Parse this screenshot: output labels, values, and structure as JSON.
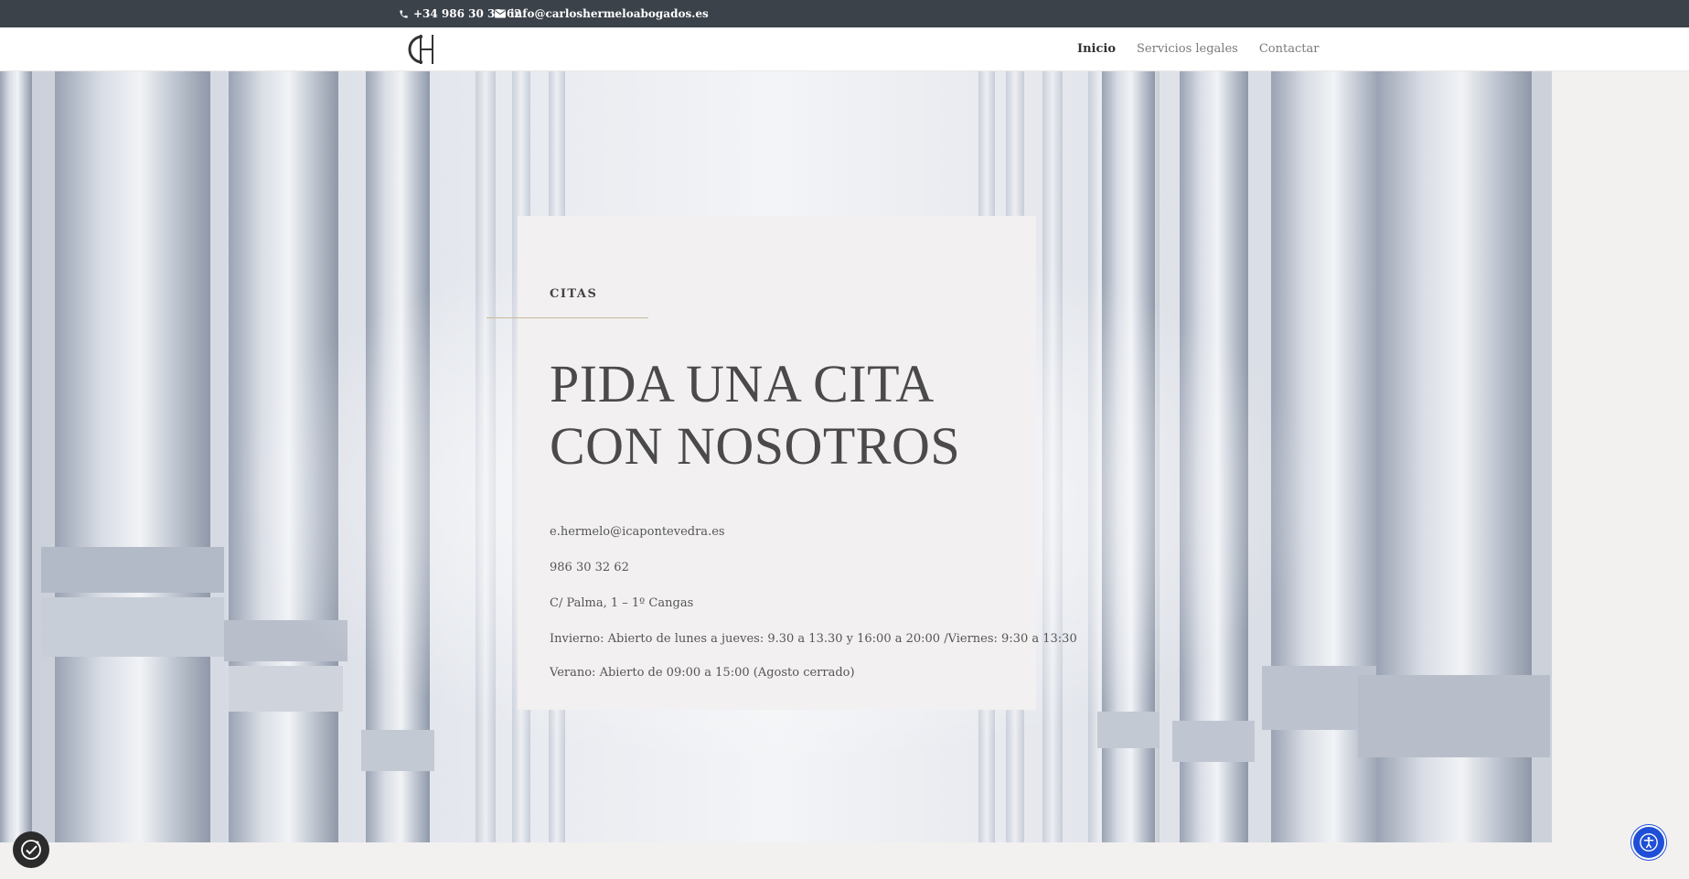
{
  "topbar": {
    "phone": "+34 986 30 32 62",
    "email": "info@carloshermeloabogados.es",
    "phone_icon": "phone-icon",
    "email_icon": "envelope-icon"
  },
  "header": {
    "logo_icon": "ch-monogram-logo",
    "nav": [
      {
        "label": "Inicio",
        "active": true
      },
      {
        "label": "Servicios legales",
        "active": false
      },
      {
        "label": "Contactar",
        "active": false
      }
    ]
  },
  "card": {
    "eyebrow": "CITAS",
    "title_line1": "PIDA UNA CITA",
    "title_line2": "CON NOSOTROS",
    "email": "e.hermelo@icapontevedra.es",
    "phone": "986 30 32 62",
    "address": "C/ Palma, 1 – 1º  Cangas",
    "hours_winter": "Invierno: Abierto de lunes a jueves: 9.30 a 13.30 y 16:00 a 20:00 /Viernes: 9:30 a 13:30",
    "hours_summer": "Verano: Abierto de 09:00 a 15:00 (Agosto cerrado)"
  },
  "floating": {
    "cookie_icon": "cookie-consent-icon",
    "accessibility_icon": "accessibility-icon"
  },
  "colors": {
    "topbar_bg": "#3c424a",
    "accent_rule": "#c9b99a",
    "accessibility_blue": "#1f4fd6"
  }
}
